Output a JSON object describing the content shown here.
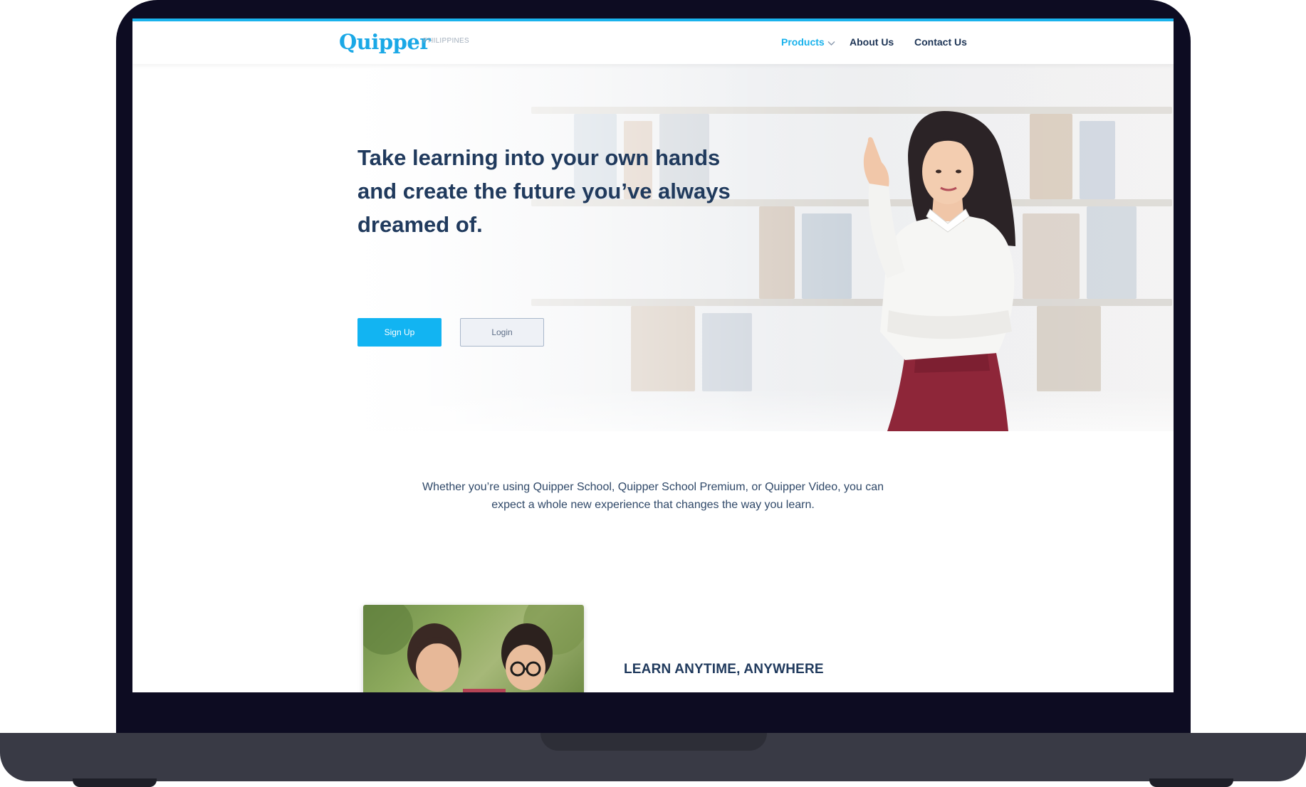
{
  "header": {
    "logo": "Quipper",
    "logo_sub": "PHILIPPINES",
    "nav": {
      "products": "Products",
      "about": "About Us",
      "contact": "Contact Us"
    }
  },
  "hero": {
    "title": "Take learning into your own hands and create the future you’ve always dreamed of.",
    "signup_label": "Sign Up",
    "login_label": "Login"
  },
  "intro": {
    "text": "Whether you’re using Quipper School, Quipper School Premium, or Quipper Video, you can expect a whole new experience that changes the way you learn."
  },
  "feature": {
    "heading": "LEARN ANYTIME, ANYWHERE"
  },
  "colors": {
    "brand": "#1aa8e6",
    "primary_button": "#12b4f2",
    "heading_text": "#203a5d",
    "frame": "#0d0c22"
  }
}
